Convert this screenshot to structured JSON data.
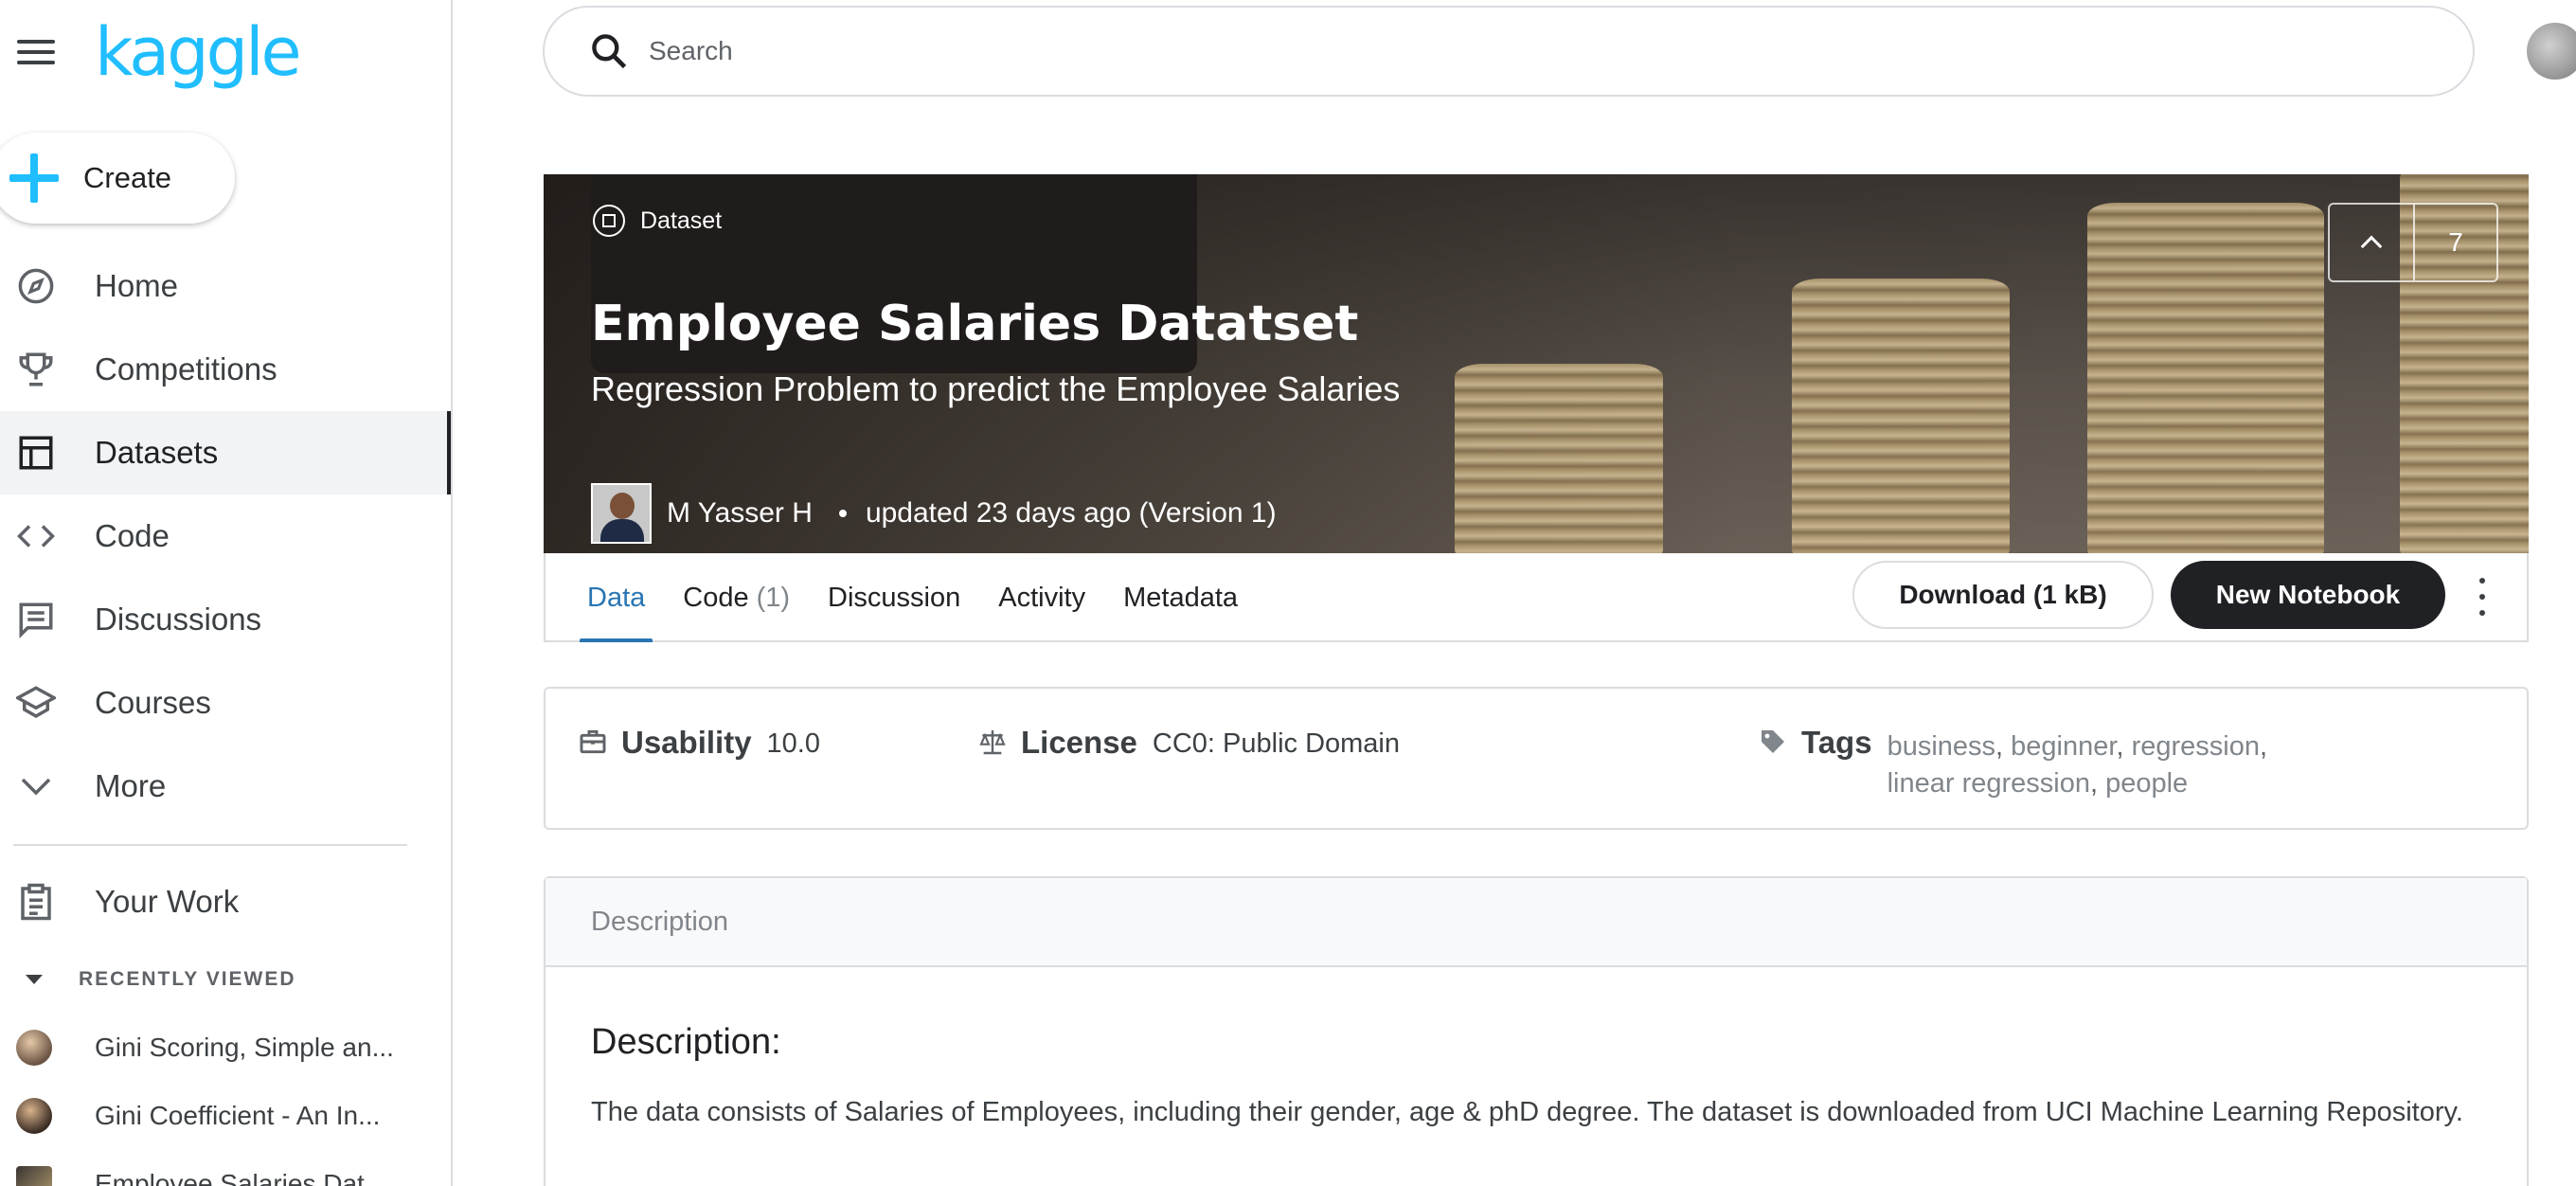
{
  "app": {
    "logo": "kaggle"
  },
  "sidebar": {
    "create_label": "Create",
    "items": [
      {
        "label": "Home",
        "icon": "compass-icon"
      },
      {
        "label": "Competitions",
        "icon": "trophy-icon"
      },
      {
        "label": "Datasets",
        "icon": "table-icon",
        "active": true
      },
      {
        "label": "Code",
        "icon": "code-icon"
      },
      {
        "label": "Discussions",
        "icon": "comment-icon"
      },
      {
        "label": "Courses",
        "icon": "school-icon"
      },
      {
        "label": "More",
        "icon": "chevron-down-icon"
      }
    ],
    "your_work": "Your Work",
    "recently_viewed_header": "RECENTLY VIEWED",
    "recent": [
      {
        "title": "Gini Scoring, Simple an..."
      },
      {
        "title": "Gini Coefficient - An In..."
      },
      {
        "title": "Employee Salaries Dat..."
      }
    ]
  },
  "search": {
    "placeholder": "Search"
  },
  "dataset": {
    "type_label": "Dataset",
    "title": "Employee Salaries Datatset",
    "subtitle": "Regression Problem to predict the Employee Salaries",
    "author": "M Yasser H",
    "updated": "updated 23 days ago (Version 1)",
    "votes": "7"
  },
  "tabs": [
    {
      "label": "Data",
      "count": "",
      "active": true
    },
    {
      "label": "Code",
      "count": "(1)"
    },
    {
      "label": "Discussion",
      "count": ""
    },
    {
      "label": "Activity",
      "count": ""
    },
    {
      "label": "Metadata",
      "count": ""
    }
  ],
  "actions": {
    "download": "Download (1 kB)",
    "new_notebook": "New Notebook"
  },
  "info": {
    "usability_label": "Usability",
    "usability_value": "10.0",
    "license_label": "License",
    "license_value": "CC0: Public Domain",
    "tags_label": "Tags",
    "tags": [
      "business",
      "beginner",
      "regression",
      "linear regression",
      "people"
    ]
  },
  "description": {
    "header": "Description",
    "heading": "Description:",
    "body": "The data consists of Salaries of Employees, including their gender, age & phD degree. The dataset is downloaded from UCI Machine Learning Repository."
  },
  "colors": {
    "brand": "#20beff",
    "accent": "#2975b3",
    "dark_button": "#202124"
  }
}
